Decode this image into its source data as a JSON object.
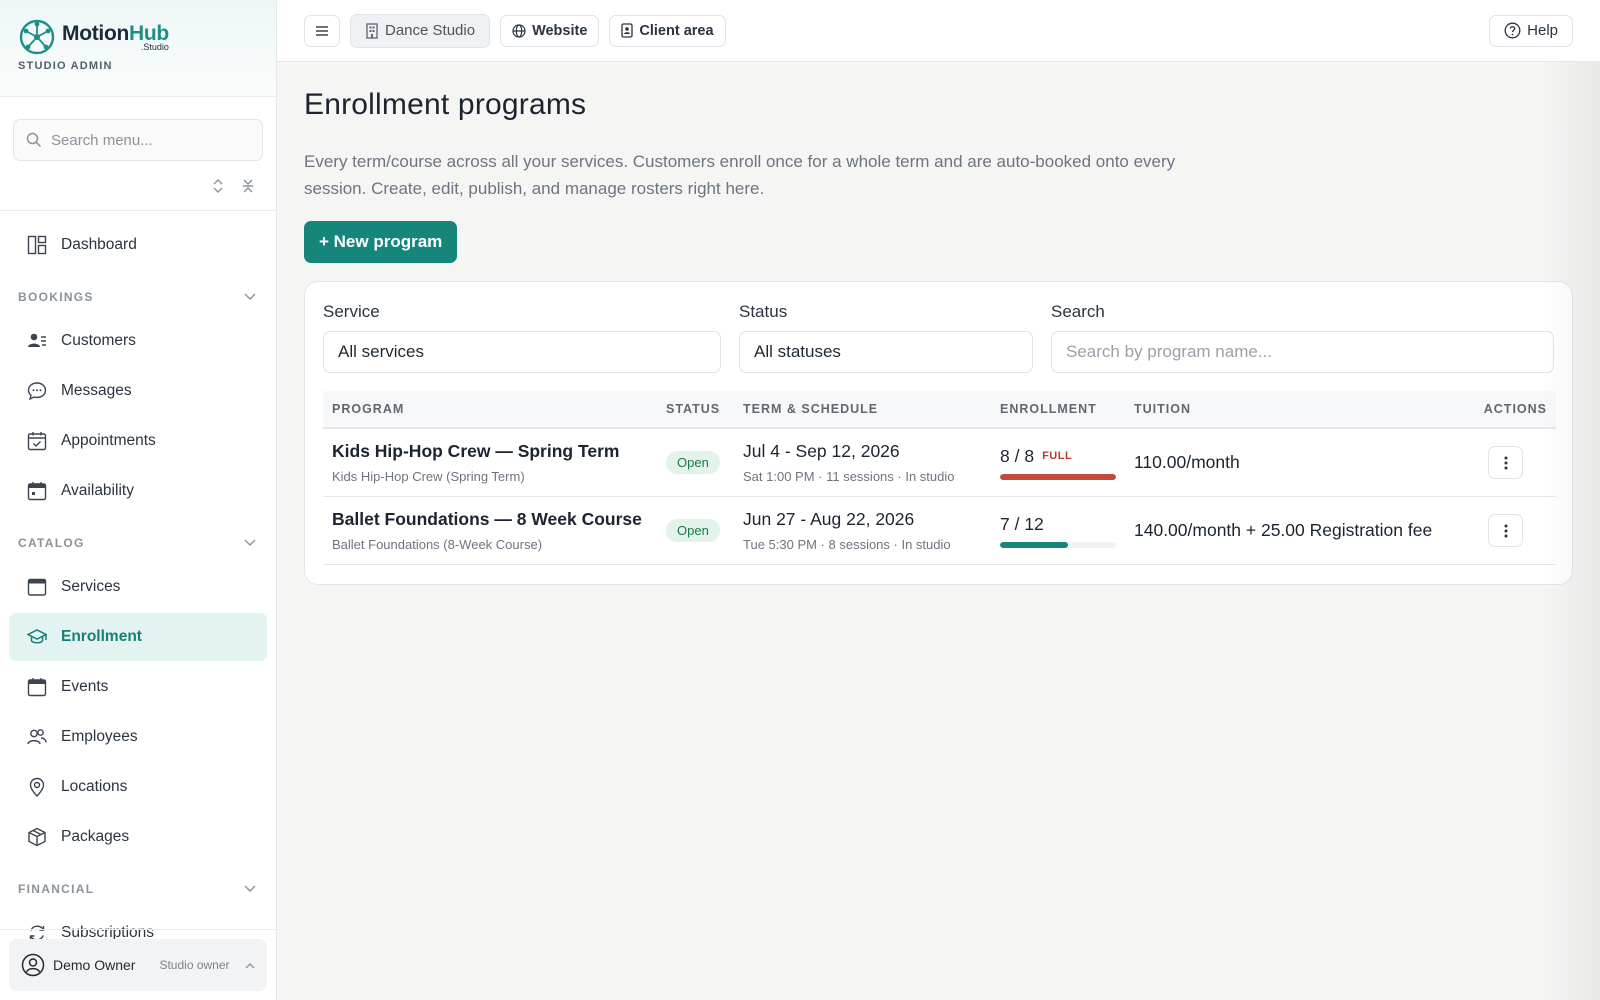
{
  "brand": {
    "name_a": "Motion",
    "name_b": "Hub",
    "tld": ".Studio",
    "subtitle": "STUDIO ADMIN"
  },
  "sidebar": {
    "search_placeholder": "Search menu...",
    "dashboard": "Dashboard",
    "sections": [
      {
        "title": "BOOKINGS",
        "items": [
          {
            "label": "Customers",
            "icon": "users-icon"
          },
          {
            "label": "Messages",
            "icon": "chat-icon"
          },
          {
            "label": "Appointments",
            "icon": "calendar-check-icon"
          },
          {
            "label": "Availability",
            "icon": "calendar-icon"
          }
        ]
      },
      {
        "title": "CATALOG",
        "items": [
          {
            "label": "Services",
            "icon": "window-icon"
          },
          {
            "label": "Enrollment",
            "icon": "graduation-cap-icon",
            "active": true
          },
          {
            "label": "Events",
            "icon": "calendar-icon"
          },
          {
            "label": "Employees",
            "icon": "people-icon"
          },
          {
            "label": "Locations",
            "icon": "map-pin-icon"
          },
          {
            "label": "Packages",
            "icon": "box-icon"
          }
        ]
      },
      {
        "title": "FINANCIAL",
        "items": [
          {
            "label": "Subscriptions",
            "icon": "refresh-icon"
          }
        ]
      }
    ],
    "user": {
      "name": "Demo Owner",
      "role": "Studio owner"
    }
  },
  "topbar": {
    "studio": "Dance Studio",
    "website": "Website",
    "client_area": "Client area",
    "help": "Help"
  },
  "page": {
    "title": "Enrollment programs",
    "description": "Every term/course across all your services. Customers enroll once for a whole term and are auto-booked onto every session. Create, edit, publish, and manage rosters right here.",
    "new_button": "+ New program"
  },
  "filters": {
    "service_label": "Service",
    "service_value": "All services",
    "status_label": "Status",
    "status_value": "All statuses",
    "search_label": "Search",
    "search_placeholder": "Search by program name..."
  },
  "table": {
    "headers": {
      "program": "PROGRAM",
      "status": "STATUS",
      "term": "TERM & SCHEDULE",
      "enrollment": "ENROLLMENT",
      "tuition": "TUITION",
      "actions": "ACTIONS"
    },
    "rows": [
      {
        "name": "Kids Hip-Hop Crew — Spring Term",
        "sub": "Kids Hip-Hop Crew (Spring Term)",
        "status": "Open",
        "dates": "Jul 4 - Sep 12, 2026",
        "schedule": "Sat 1:00 PM · 11 sessions · In studio",
        "enrollment": "8 / 8",
        "full_tag": "FULL",
        "fill_fraction": 1.0,
        "fill_color": "#c24a3a",
        "tuition": "110.00/month"
      },
      {
        "name": "Ballet Foundations — 8 Week Course",
        "sub": "Ballet Foundations (8-Week Course)",
        "status": "Open",
        "dates": "Jun 27 - Aug 22, 2026",
        "schedule": "Tue 5:30 PM · 8 sessions · In studio",
        "enrollment": "7 / 12",
        "full_tag": "",
        "fill_fraction": 0.583,
        "fill_color": "#16857c",
        "tuition": "140.00/month + 25.00 Registration fee"
      }
    ]
  },
  "colors": {
    "accent": "#16857c",
    "full": "#c24a3a",
    "open_badge_bg": "#e3f3ea"
  }
}
